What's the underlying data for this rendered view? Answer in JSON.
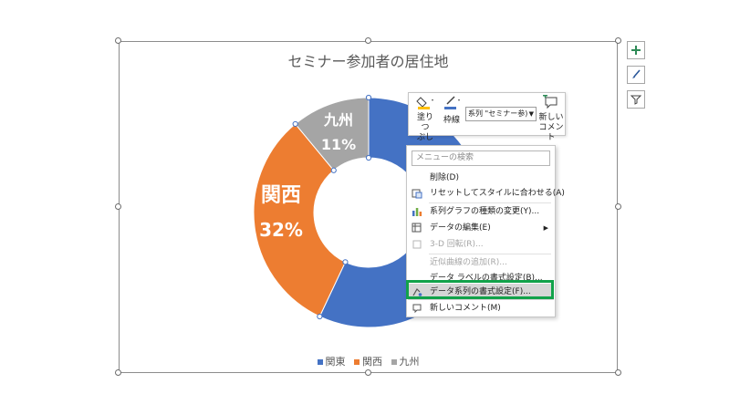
{
  "chart": {
    "title": "セミナー参加者の居住地",
    "label_kyushu_name": "九州",
    "label_kyushu_pct": "11%",
    "label_kansai_name": "関西",
    "label_kansai_pct": "32%",
    "legend": [
      "関東",
      "関西",
      "九州"
    ]
  },
  "chart_data": {
    "type": "pie",
    "title": "セミナー参加者の居住地",
    "categories": [
      "関東",
      "関西",
      "九州"
    ],
    "values": [
      57,
      32,
      11
    ],
    "colors": [
      "#4472c4",
      "#ed7d31",
      "#a5a5a5"
    ],
    "data_labels": [
      "",
      "関西 32%",
      "九州 11%"
    ],
    "legend_position": "bottom"
  },
  "side_buttons": [
    "plus-icon",
    "brush-icon",
    "filter-icon"
  ],
  "mini_toolbar": {
    "fill_label_1": "塗りつ",
    "fill_label_2": "ぶし",
    "outline_label": "枠線",
    "series_value": "系列 \"セミナー参)",
    "comment_label_1": "新しい",
    "comment_label_2": "コメント"
  },
  "context_menu": {
    "search_placeholder": "メニューの検索",
    "items": [
      {
        "label": "削除(D)",
        "icon": "",
        "disabled": false
      },
      {
        "label": "リセットしてスタイルに合わせる(A)",
        "icon": "reset-style-icon",
        "disabled": false
      },
      {
        "label": "系列グラフの種類の変更(Y)...",
        "icon": "chart-type-icon",
        "disabled": false
      },
      {
        "label": "データの編集(E)",
        "icon": "edit-data-icon",
        "disabled": false,
        "submenu": true
      },
      {
        "label": "3-D 回転(R)...",
        "icon": "rotate-3d-icon",
        "disabled": true
      },
      {
        "label": "近似曲線の追加(R)...",
        "icon": "",
        "disabled": true
      },
      {
        "label": "データ ラベルの書式設定(B)...",
        "icon": "",
        "disabled": false
      },
      {
        "label": "データ系列の書式設定(F)...",
        "icon": "format-series-icon",
        "disabled": false,
        "highlighted": true
      },
      {
        "label": "新しいコメント(M)",
        "icon": "comment-icon",
        "disabled": false
      }
    ]
  },
  "colors": {
    "highlight_box": "#12a24a"
  }
}
